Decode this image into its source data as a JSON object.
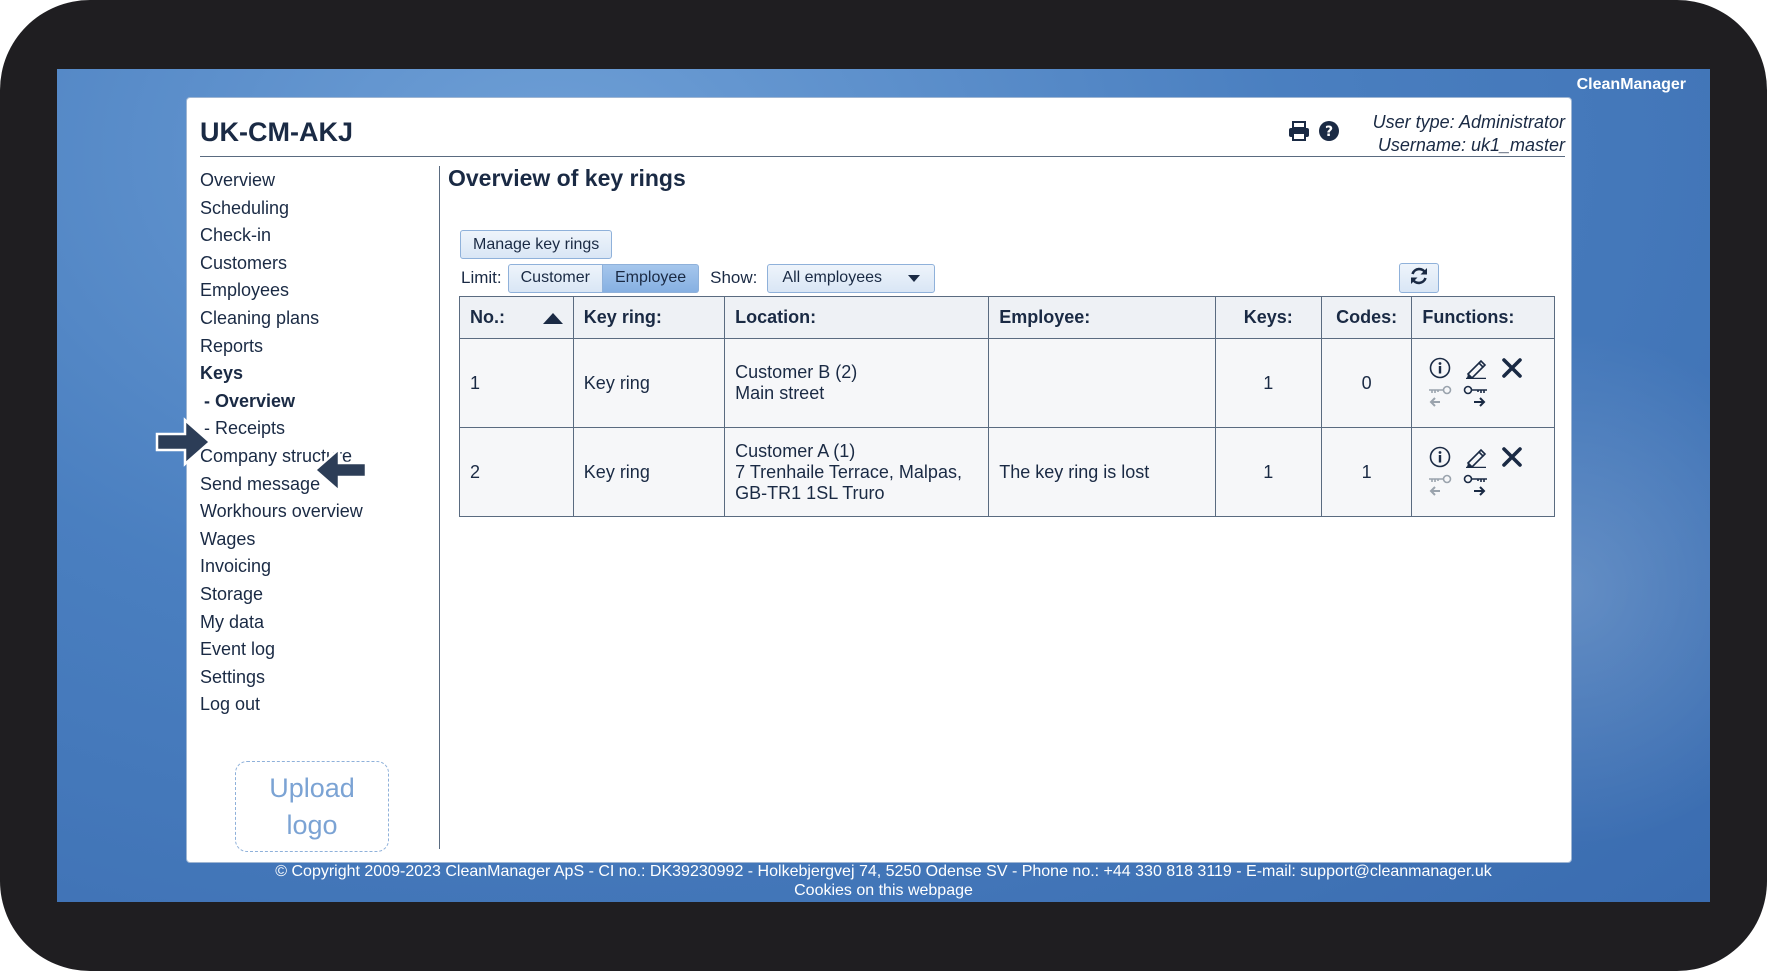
{
  "brand": "CleanManager",
  "header": {
    "site_title": "UK-CM-AKJ",
    "user_type": "User type: Administrator",
    "username": "Username: uk1_master"
  },
  "menu": {
    "items": [
      "Overview",
      "Scheduling",
      "Check-in",
      "Customers",
      "Employees",
      "Cleaning plans",
      "Reports"
    ],
    "keys": "Keys",
    "keys_overview": "- Overview",
    "keys_receipts": "- Receipts",
    "items_after": [
      "Company structure",
      "Send message",
      "Workhours overview",
      "Wages",
      "Invoicing",
      "Storage",
      "My data",
      "Event log",
      "Settings",
      "Log out"
    ]
  },
  "upload": {
    "line1": "Upload",
    "line2": "logo"
  },
  "main": {
    "title": "Overview of key rings",
    "manage_button": "Manage key rings",
    "limit_label": "Limit:",
    "limit_options": [
      "Customer",
      "Employee"
    ],
    "show_label": "Show:",
    "show_value": "All employees"
  },
  "table": {
    "headers": [
      "No.:",
      "Key ring:",
      "Location:",
      "Employee:",
      "Keys:",
      "Codes:",
      "Functions:"
    ],
    "rows": [
      {
        "no": "1",
        "key_ring": "Key ring",
        "location_1": "Customer B (2)",
        "location_2": "Main street",
        "location_3": "",
        "employee": "",
        "keys": "1",
        "codes": "0"
      },
      {
        "no": "2",
        "key_ring": "Key ring",
        "location_1": "Customer A (1)",
        "location_2": "7 Trenhaile Terrace, Malpas,",
        "location_3": "GB-TR1 1SL Truro",
        "employee": "The key ring is lost",
        "keys": "1",
        "codes": "1"
      }
    ]
  },
  "footer": {
    "copyright": "© Copyright 2009-2023 CleanManager ApS - CI no.: DK39230992 - Holkebjergvej 74, 5250 Odense SV - Phone no.: +44 330 818 3119 - E-mail: support@cleanmanager.uk",
    "cookies": "Cookies on this webpage"
  },
  "colors": {
    "accent": "#86b0e2",
    "text": "#1a2a44",
    "background": "#4a7fc0"
  },
  "icons": [
    "print-icon",
    "help-icon",
    "info-icon",
    "edit-icon",
    "delete-icon",
    "key-return-icon",
    "key-handout-icon",
    "refresh-icon",
    "arrow-right-icon",
    "arrow-left-icon"
  ]
}
